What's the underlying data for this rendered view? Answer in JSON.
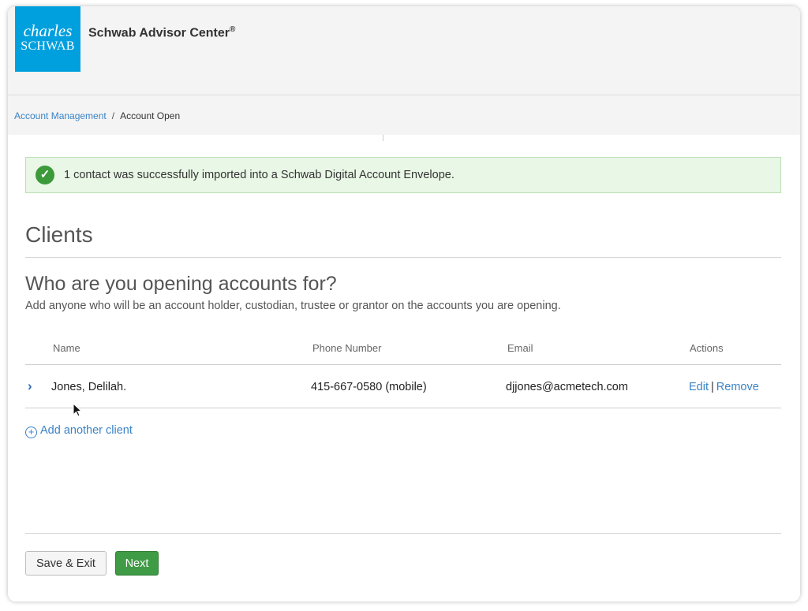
{
  "header": {
    "logo_line1": "charles",
    "logo_line2": "SCHWAB",
    "app_title": "Schwab Advisor Center",
    "registered_mark": "®"
  },
  "breadcrumb": {
    "items": [
      "Account Management",
      "Account Open"
    ],
    "separator": "/"
  },
  "alert": {
    "icon": "check-circle-icon",
    "message": "1 contact was successfully imported into a Schwab Digital Account Envelope."
  },
  "page": {
    "title": "Clients",
    "question": "Who are you opening accounts for?",
    "description": "Add anyone who will be an account holder, custodian, trustee or grantor on the accounts you are opening."
  },
  "table": {
    "headers": [
      "Name",
      "Phone Number",
      "Email",
      "Actions"
    ],
    "rows": [
      {
        "name": "Jones, Delilah.",
        "phone": "415-667-0580 (mobile)",
        "email": "djjones@acmetech.com",
        "edit_label": "Edit",
        "remove_label": "Remove"
      }
    ],
    "action_separator": "|"
  },
  "add_client": {
    "icon": "plus-circle-icon",
    "label": "Add another client"
  },
  "footer": {
    "save_exit_label": "Save & Exit",
    "next_label": "Next"
  },
  "colors": {
    "brand_blue": "#00a0df",
    "link_blue": "#3a83c6",
    "success_green": "#3c9a3a",
    "next_green": "#3f9b45",
    "alert_bg": "#e9f7e6"
  }
}
